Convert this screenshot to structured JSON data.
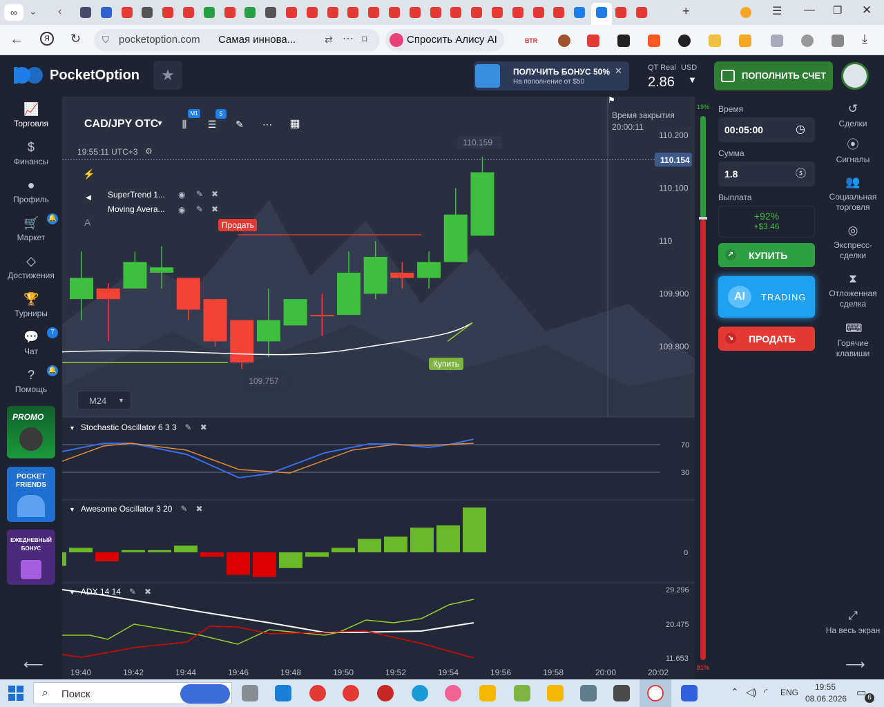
{
  "browser": {
    "url": "pocketoption.com",
    "page_title": "Самая иннова...",
    "alice_label": "Спросить Алису AI"
  },
  "header": {
    "logo_text": "PocketOption",
    "bonus_title": "ПОЛУЧИТЬ БОНУС 50%",
    "bonus_sub": "На пополнение от $50",
    "account_label": "QT Real",
    "currency": "USD",
    "balance": "2.86",
    "deposit_label": "ПОПОЛНИТЬ СЧЕТ"
  },
  "left_nav": {
    "items": [
      {
        "label": "Торговля",
        "icon": "chart-icon"
      },
      {
        "label": "Финансы",
        "icon": "dollar-icon"
      },
      {
        "label": "Профиль",
        "icon": "user-icon"
      },
      {
        "label": "Маркет",
        "icon": "cart-icon"
      },
      {
        "label": "Достижения",
        "icon": "diamond-icon"
      },
      {
        "label": "Турниры",
        "icon": "trophy-icon"
      },
      {
        "label": "Чат",
        "icon": "chat-icon",
        "badge": "7"
      },
      {
        "label": "Помощь",
        "icon": "help-icon"
      }
    ],
    "promo": "PROMO",
    "friends": "POCKET FRIENDS",
    "daily": "ЕЖЕДНЕВНЫЙ БОНУС"
  },
  "chart_toolbar": {
    "asset": "CAD/JPY OTC",
    "timeframe_badge": "M1",
    "indicators_badge": "5",
    "time": "19:55:11 UTC+3",
    "timeframe_select": "M24"
  },
  "indicators": {
    "supertrend": "SuperTrend 1...",
    "moving_avg": "Moving Avera...",
    "stochastic": "Stochastic Oscillator  6 3 3",
    "awesome": "Awesome Oscillator  3 20",
    "adx": "ADX  14 14"
  },
  "chart_labels": {
    "close_time_label": "Время закрытия",
    "close_time": "20:00:11",
    "sell_marker": "Продать",
    "buy_marker": "Купить",
    "high_label": "110.159",
    "low_label": "109.757",
    "current_price": "110.154",
    "pct_up": "19%",
    "pct_down": "81%"
  },
  "chart_data": {
    "type": "candlestick",
    "x": [
      "19:40",
      "19:42",
      "19:44",
      "19:46",
      "19:48",
      "19:50",
      "19:52",
      "19:54",
      "19:56",
      "19:58",
      "20:00",
      "20:02"
    ],
    "price_ticks": [
      "110.200",
      "110.100",
      "110",
      "109.900",
      "109.800"
    ],
    "candles": [
      {
        "o": 109.89,
        "c": 109.93,
        "h": 109.98,
        "l": 109.85,
        "up": true
      },
      {
        "o": 109.91,
        "c": 109.89,
        "h": 109.92,
        "l": 109.81,
        "up": false
      },
      {
        "o": 109.91,
        "c": 109.96,
        "h": 109.98,
        "l": 109.91,
        "up": true
      },
      {
        "o": 109.95,
        "c": 109.94,
        "h": 109.99,
        "l": 109.91,
        "up": true
      },
      {
        "o": 109.93,
        "c": 109.87,
        "h": 109.93,
        "l": 109.85,
        "up": false
      },
      {
        "o": 109.89,
        "c": 109.81,
        "h": 109.89,
        "l": 109.8,
        "up": false
      },
      {
        "o": 109.85,
        "c": 109.77,
        "h": 109.85,
        "l": 109.757,
        "up": false
      },
      {
        "o": 109.81,
        "c": 109.85,
        "h": 109.91,
        "l": 109.78,
        "up": true
      },
      {
        "o": 109.84,
        "c": 109.89,
        "h": 109.89,
        "l": 109.84,
        "up": true
      },
      {
        "o": 109.86,
        "c": 109.86,
        "h": 109.9,
        "l": 109.82,
        "up": false
      },
      {
        "o": 109.86,
        "c": 109.94,
        "h": 109.98,
        "l": 109.86,
        "up": true
      },
      {
        "o": 109.9,
        "c": 109.97,
        "h": 110.0,
        "l": 109.89,
        "up": true
      },
      {
        "o": 109.94,
        "c": 109.93,
        "h": 109.96,
        "l": 109.91,
        "up": false
      },
      {
        "o": 109.93,
        "c": 109.96,
        "h": 109.98,
        "l": 109.91,
        "up": true
      },
      {
        "o": 109.96,
        "c": 110.05,
        "h": 110.1,
        "l": 109.96,
        "up": true
      },
      {
        "o": 110.01,
        "c": 110.13,
        "h": 110.159,
        "l": 110.01,
        "up": true
      }
    ],
    "stoch_levels": [
      "70",
      "30"
    ],
    "ao_level": "0",
    "ao_values": [
      -0.3,
      0.1,
      -0.2,
      0.05,
      0.05,
      0.15,
      -0.1,
      -0.5,
      -0.55,
      -0.35,
      -0.1,
      0.1,
      0.3,
      0.35,
      0.55,
      0.6,
      1.0
    ],
    "adx_ticks": [
      "29.296",
      "20.475",
      "11.653"
    ]
  },
  "trade_panel": {
    "time_label": "Время",
    "time_value": "00:05:00",
    "amount_label": "Сумма",
    "amount_value": "1.8",
    "payout_label": "Выплата",
    "payout_pct": "+92%",
    "payout_amount": "+$3.46",
    "buy_label": "КУПИТЬ",
    "ai_label": "AI",
    "ai_text": "TRADING",
    "sell_label": "ПРОДАТЬ"
  },
  "right_nav": {
    "items": [
      {
        "label": "Сделки",
        "icon": "history-icon"
      },
      {
        "label": "Сигналы",
        "icon": "signal-icon"
      },
      {
        "label": "Социальная торговля",
        "icon": "social-icon"
      },
      {
        "label": "Экспресс-сделки",
        "icon": "target-icon"
      },
      {
        "label": "Отложенная сделка",
        "icon": "hourglass-icon"
      },
      {
        "label": "Горячие клавиши",
        "icon": "keyboard-icon"
      }
    ],
    "fullscreen_label": "На весь экран"
  },
  "taskbar": {
    "search_placeholder": "Поиск",
    "lang": "ENG",
    "time": "19:55",
    "date": "08.06.2026",
    "notifications": "6"
  },
  "colors": {
    "up": "#3fbf3f",
    "down": "#f44336",
    "accent": "#2e7d32",
    "ai": "#1fa0f0"
  }
}
